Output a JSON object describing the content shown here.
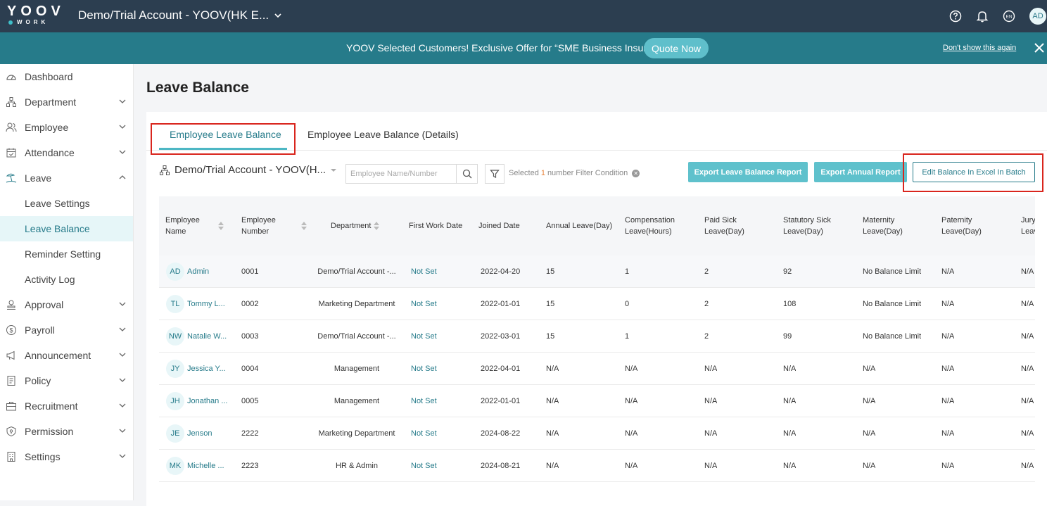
{
  "topbar": {
    "logo_top": "YOOV",
    "logo_bottom": "WORK",
    "account": "Demo/Trial Account - YOOV(HK E...",
    "lang": "EN",
    "avatar": "AD"
  },
  "banner": {
    "text": "YOOV Selected Customers! Exclusive Offer for “SME Business Insurance”",
    "quote_button": "Quote Now",
    "dont_show": "Don't show this again"
  },
  "sidebar": {
    "items": [
      {
        "label": "Dashboard",
        "icon": "dashboard-icon"
      },
      {
        "label": "Department",
        "icon": "department-icon"
      },
      {
        "label": "Employee",
        "icon": "employee-icon"
      },
      {
        "label": "Attendance",
        "icon": "attendance-icon"
      },
      {
        "label": "Leave",
        "icon": "leave-icon"
      },
      {
        "label": "Approval",
        "icon": "approval-icon"
      },
      {
        "label": "Payroll",
        "icon": "payroll-icon"
      },
      {
        "label": "Announcement",
        "icon": "announcement-icon"
      },
      {
        "label": "Policy",
        "icon": "policy-icon"
      },
      {
        "label": "Recruitment",
        "icon": "recruitment-icon"
      },
      {
        "label": "Permission",
        "icon": "permission-icon"
      },
      {
        "label": "Settings",
        "icon": "settings-icon"
      }
    ],
    "leave_sub": [
      "Leave Settings",
      "Leave Balance",
      "Reminder Setting",
      "Activity Log"
    ]
  },
  "page": {
    "title": "Leave Balance",
    "tabs": [
      "Employee Leave Balance",
      "Employee Leave Balance (Details)"
    ]
  },
  "filters": {
    "department": "Demo/Trial Account - YOOV(H...",
    "search_placeholder": "Employee Name/Number",
    "selected_prefix": "Selected",
    "selected_count": "1",
    "selected_suffix": "number Filter Condition",
    "export_leave": "Export Leave Balance Report",
    "export_annual": "Export Annual Report",
    "edit_batch": "Edit Balance In Excel In Batch"
  },
  "table": {
    "headers": [
      "Employee\nName",
      "Employee\nNumber",
      "Department",
      "First Work Date",
      "Joined Date",
      "Annual Leave(Day)",
      "Compensation\nLeave(Hours)",
      "Paid Sick\nLeave(Day)",
      "Statutory Sick\nLeave(Day)",
      "Maternity\nLeave(Day)",
      "Paternity\nLeave(Day)",
      "Jury\nLeav"
    ],
    "rows": [
      {
        "initials": "AD",
        "name": "Admin",
        "number": "0001",
        "dept": "Demo/Trial Account -...",
        "first": "Not Set",
        "joined": "2022-04-20",
        "annual": "15",
        "comp": "1",
        "paid_sick": "2",
        "stat_sick": "92",
        "maternity": "No Balance Limit",
        "paternity": "N/A",
        "jury": "N/A"
      },
      {
        "initials": "TL",
        "name": "Tommy L...",
        "number": "0002",
        "dept": "Marketing Department",
        "first": "Not Set",
        "joined": "2022-01-01",
        "annual": "15",
        "comp": "0",
        "paid_sick": "2",
        "stat_sick": "108",
        "maternity": "No Balance Limit",
        "paternity": "N/A",
        "jury": "N/A"
      },
      {
        "initials": "NW",
        "name": "Natalie W...",
        "number": "0003",
        "dept": "Demo/Trial Account -...",
        "first": "Not Set",
        "joined": "2022-03-01",
        "annual": "15",
        "comp": "1",
        "paid_sick": "2",
        "stat_sick": "99",
        "maternity": "No Balance Limit",
        "paternity": "N/A",
        "jury": "N/A"
      },
      {
        "initials": "JY",
        "name": "Jessica Y...",
        "number": "0004",
        "dept": "Management",
        "first": "Not Set",
        "joined": "2022-04-01",
        "annual": "N/A",
        "comp": "N/A",
        "paid_sick": "N/A",
        "stat_sick": "N/A",
        "maternity": "N/A",
        "paternity": "N/A",
        "jury": "N/A"
      },
      {
        "initials": "JH",
        "name": "Jonathan ...",
        "number": "0005",
        "dept": "Management",
        "first": "Not Set",
        "joined": "2022-01-01",
        "annual": "N/A",
        "comp": "N/A",
        "paid_sick": "N/A",
        "stat_sick": "N/A",
        "maternity": "N/A",
        "paternity": "N/A",
        "jury": "N/A"
      },
      {
        "initials": "JE",
        "name": "Jenson",
        "number": "2222",
        "dept": "Marketing Department",
        "first": "Not Set",
        "joined": "2024-08-22",
        "annual": "N/A",
        "comp": "N/A",
        "paid_sick": "N/A",
        "stat_sick": "N/A",
        "maternity": "N/A",
        "paternity": "N/A",
        "jury": "N/A"
      },
      {
        "initials": "MK",
        "name": "Michelle ...",
        "number": "2223",
        "dept": "HR & Admin",
        "first": "Not Set",
        "joined": "2024-08-21",
        "annual": "N/A",
        "comp": "N/A",
        "paid_sick": "N/A",
        "stat_sick": "N/A",
        "maternity": "N/A",
        "paternity": "N/A",
        "jury": "N/A"
      }
    ]
  },
  "colors": {
    "topbar": "#2c3e50",
    "banner": "#267b8a",
    "accent": "#5fc1cc",
    "highlight_box": "#d9251d"
  }
}
